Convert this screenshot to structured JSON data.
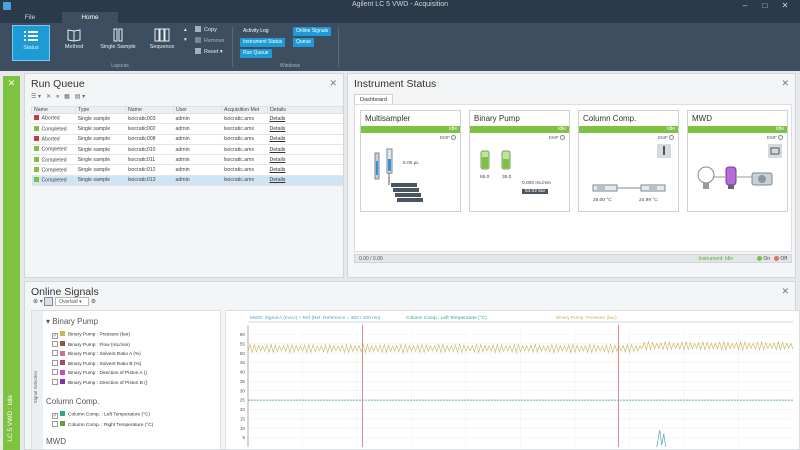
{
  "window": {
    "title": "Agilent LC 5 VWD - Acquisition"
  },
  "ribbon": {
    "tabs": [
      "File",
      "Home"
    ],
    "buttons": [
      {
        "label": "Status",
        "icon": "list-icon"
      },
      {
        "label": "Method",
        "icon": "book-icon"
      },
      {
        "label": "Single Sample",
        "icon": "vial-icon"
      },
      {
        "label": "Sequence",
        "icon": "columns-icon"
      }
    ],
    "small_commands": [
      {
        "label": "Copy",
        "icon": "copy-icon"
      },
      {
        "label": "Remove",
        "icon": "remove-icon"
      },
      {
        "label": "Reset",
        "icon": "reset-icon"
      }
    ],
    "window_buttons": [
      {
        "label": "Activity Log",
        "on": false
      },
      {
        "label": "Online Signals",
        "on": true
      },
      {
        "label": "Instrument Status",
        "on": true
      },
      {
        "label": "Queue",
        "on": true
      },
      {
        "label": "Run Queue",
        "on": true
      }
    ],
    "group_labels": [
      "Layouts",
      "Windows"
    ]
  },
  "leftstrip": {
    "label": "LC 5 VWD : Idle",
    "accent": "#7fc241"
  },
  "run_queue": {
    "title": "Run Queue",
    "columns": [
      "Name",
      "Type",
      "Name",
      "User",
      "Acquisition Met",
      "Details"
    ],
    "rows": [
      {
        "status": "Aborted",
        "color": "#d9333f",
        "type": "Single sample",
        "name": "Isocratic003",
        "user": "admin",
        "method": "Isocratic.amx",
        "details": "Details"
      },
      {
        "status": "Completed",
        "color": "#7fc241",
        "type": "Single sample",
        "name": "Isocratic002",
        "user": "admin",
        "method": "Isocratic.amx",
        "details": "Details"
      },
      {
        "status": "Aborted",
        "color": "#d9333f",
        "type": "Single sample",
        "name": "Isocratic008",
        "user": "admin",
        "method": "Isocratic.amx",
        "details": "Details"
      },
      {
        "status": "Completed",
        "color": "#7fc241",
        "type": "Single sample",
        "name": "Isocratic010",
        "user": "admin",
        "method": "Isocratic.amx",
        "details": "Details"
      },
      {
        "status": "Completed",
        "color": "#7fc241",
        "type": "Single sample",
        "name": "Isocratic011",
        "user": "admin",
        "method": "Isocratic.amx",
        "details": "Details"
      },
      {
        "status": "Completed",
        "color": "#7fc241",
        "type": "Single sample",
        "name": "Isocratic012",
        "user": "admin",
        "method": "Isocratic.amx",
        "details": "Details"
      },
      {
        "status": "Completed",
        "color": "#7fc241",
        "type": "Single sample",
        "name": "Isocratic013",
        "user": "admin",
        "method": "Isocratic.amx",
        "details": "Details",
        "selected": true
      }
    ]
  },
  "instrument_status": {
    "title": "Instrument Status",
    "tab": "Dashboard",
    "modules": [
      {
        "name": "Multisampler",
        "state": "Idle",
        "emf": "EMF",
        "values": [
          "5.00 µL"
        ]
      },
      {
        "name": "Binary Pump",
        "state": "Idle",
        "emf": "EMF",
        "values": [
          "65.0",
          "35.0",
          "0.000 mL/min",
          "54.02 bar"
        ]
      },
      {
        "name": "Column Comp.",
        "state": "Idle",
        "emf": "EMF",
        "values": [
          "25.00 °C",
          "24.99 °C"
        ]
      },
      {
        "name": "MWD",
        "state": "Idle",
        "emf": "EMF",
        "values": []
      }
    ],
    "footer_left": "0.00 / 0.00",
    "footer_ready": "Instrument: Idle",
    "on_label": "On",
    "off_label": "Off"
  },
  "online_signals": {
    "title": "Online Signals",
    "view_select": "Overlaid",
    "selector_label": "Signal Selection",
    "groups": [
      {
        "name": "Binary Pump",
        "signals": [
          {
            "label": "Binary Pump : Pressure (bar)",
            "color": "#c8b45a",
            "checked": true
          },
          {
            "label": "Binary Pump : Flow (mL/min)",
            "color": "#8a5a3a",
            "checked": false
          },
          {
            "label": "Binary Pump : Solvent Ratio A (%)",
            "color": "#d07080",
            "checked": false
          },
          {
            "label": "Binary Pump : Solvent Ratio B (%)",
            "color": "#a04a6a",
            "checked": false
          },
          {
            "label": "Binary Pump : Direction of Piston A ()",
            "color": "#c050c0",
            "checked": false
          },
          {
            "label": "Binary Pump : Direction of Piston B ()",
            "color": "#8a2ab0",
            "checked": false
          }
        ]
      },
      {
        "name": "Column Comp.",
        "signals": [
          {
            "label": "Column Comp. : Left Temperature (°C)",
            "color": "#2ca58d",
            "checked": true
          },
          {
            "label": "Column Comp. : Right Temperature (°C)",
            "color": "#6a9a3a",
            "checked": false
          }
        ]
      },
      {
        "name": "MWD",
        "signals": []
      }
    ],
    "chart_legend": [
      {
        "label": "MWD: Signal A (mAU) + Ref (Ref. Reference = 360 / 100 nm)",
        "color": "#5aa0c8"
      },
      {
        "label": "Column Comp.: Left Temperature (°C)",
        "color": "#2ca58d"
      },
      {
        "label": "Binary Pump: Pressure (bar)",
        "color": "#c8b45a"
      }
    ]
  },
  "chart_data": {
    "type": "line",
    "ylim": [
      0,
      65
    ],
    "yticks": [
      5,
      10,
      15,
      20,
      25,
      30,
      35,
      40,
      45,
      50,
      55,
      60
    ],
    "series": [
      {
        "name": "Binary Pump: Pressure (bar)",
        "color": "#c8b45a",
        "baseline": 52.5,
        "amplitude": 2.2
      },
      {
        "name": "Column Comp.: Left Temperature (°C)",
        "color": "#2ca58d",
        "baseline": 25,
        "amplitude": 0
      }
    ],
    "markers": [
      {
        "position": 0.21,
        "color": "#e07070"
      },
      {
        "position": 0.68,
        "color": "#e07070"
      }
    ]
  }
}
